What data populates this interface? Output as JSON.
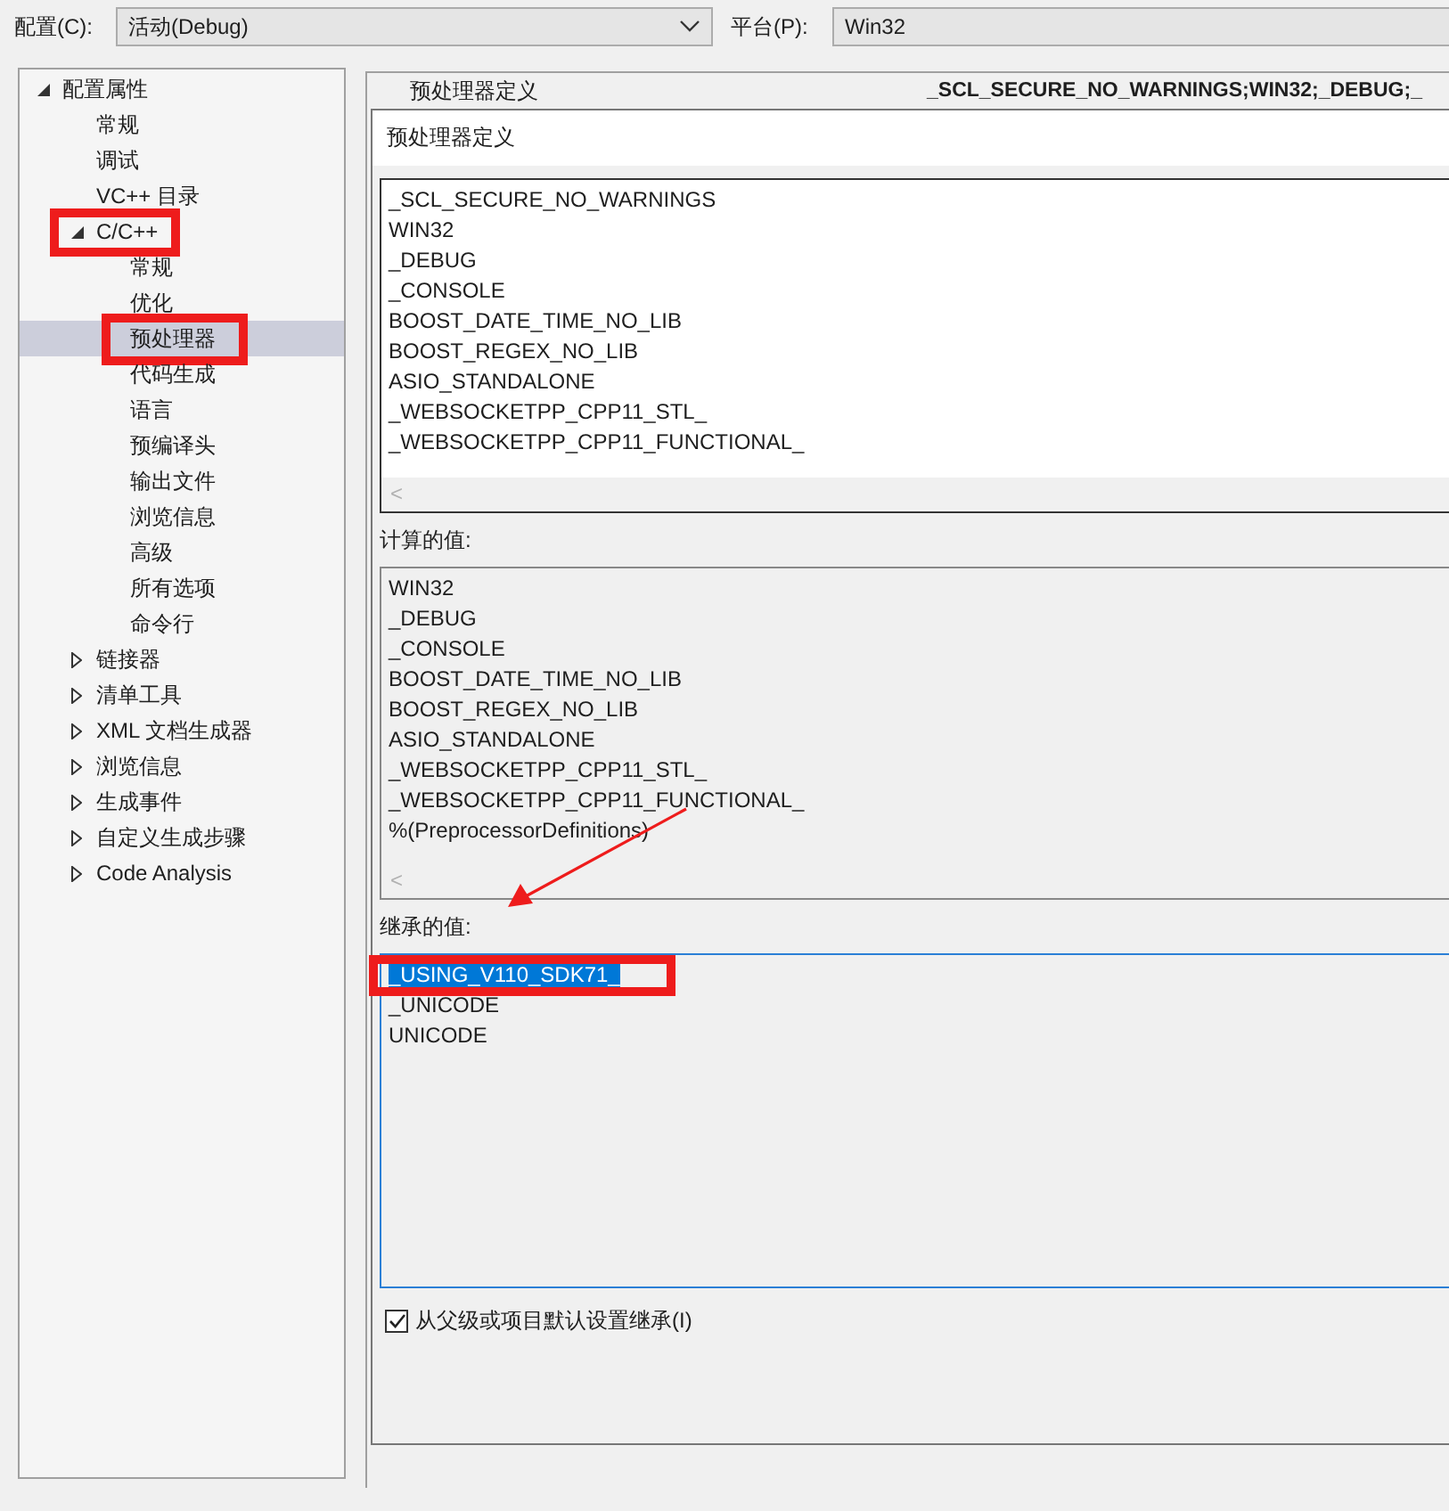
{
  "config_bar": {
    "config_label": "配置(C):",
    "config_value": "活动(Debug)",
    "platform_label": "平台(P):",
    "platform_value": "Win32"
  },
  "tree": [
    {
      "label": "配置属性",
      "expanded": true,
      "selected": false,
      "highlighted": false,
      "children": [
        {
          "label": "常规",
          "selected": false,
          "highlighted": false
        },
        {
          "label": "调试",
          "selected": false,
          "highlighted": false
        },
        {
          "label": "VC++ 目录",
          "selected": false,
          "highlighted": false
        },
        {
          "label": "C/C++",
          "expanded": true,
          "selected": false,
          "highlighted": true,
          "children": [
            {
              "label": "常规",
              "selected": false,
              "highlighted": false
            },
            {
              "label": "优化",
              "selected": false,
              "highlighted": false
            },
            {
              "label": "预处理器",
              "selected": true,
              "highlighted": true
            },
            {
              "label": "代码生成",
              "selected": false,
              "highlighted": false
            },
            {
              "label": "语言",
              "selected": false,
              "highlighted": false
            },
            {
              "label": "预编译头",
              "selected": false,
              "highlighted": false
            },
            {
              "label": "输出文件",
              "selected": false,
              "highlighted": false
            },
            {
              "label": "浏览信息",
              "selected": false,
              "highlighted": false
            },
            {
              "label": "高级",
              "selected": false,
              "highlighted": false
            },
            {
              "label": "所有选项",
              "selected": false,
              "highlighted": false
            },
            {
              "label": "命令行",
              "selected": false,
              "highlighted": false
            }
          ]
        },
        {
          "label": "链接器",
          "expanded": false,
          "selected": false,
          "highlighted": false
        },
        {
          "label": "清单工具",
          "expanded": false,
          "selected": false,
          "highlighted": false
        },
        {
          "label": "XML 文档生成器",
          "expanded": false,
          "selected": false,
          "highlighted": false
        },
        {
          "label": "浏览信息",
          "expanded": false,
          "selected": false,
          "highlighted": false
        },
        {
          "label": "生成事件",
          "expanded": false,
          "selected": false,
          "highlighted": false
        },
        {
          "label": "自定义生成步骤",
          "expanded": false,
          "selected": false,
          "highlighted": false
        },
        {
          "label": "Code Analysis",
          "expanded": false,
          "selected": false,
          "highlighted": false
        }
      ]
    }
  ],
  "property_row": {
    "name": "预处理器定义",
    "value": "_SCL_SECURE_NO_WARNINGS;WIN32;_DEBUG;_"
  },
  "editor": {
    "title": "预处理器定义",
    "definitions": [
      "_SCL_SECURE_NO_WARNINGS",
      "WIN32",
      "_DEBUG",
      "_CONSOLE",
      "BOOST_DATE_TIME_NO_LIB",
      "BOOST_REGEX_NO_LIB",
      "ASIO_STANDALONE",
      "_WEBSOCKETPP_CPP11_STL_",
      "_WEBSOCKETPP_CPP11_FUNCTIONAL_"
    ],
    "scroll_left": "<",
    "computed_label": "计算的值:",
    "computed": [
      "WIN32",
      "_DEBUG",
      "_CONSOLE",
      "BOOST_DATE_TIME_NO_LIB",
      "BOOST_REGEX_NO_LIB",
      "ASIO_STANDALONE",
      "_WEBSOCKETPP_CPP11_STL_",
      "_WEBSOCKETPP_CPP11_FUNCTIONAL_",
      "%(PreprocessorDefinitions)"
    ],
    "computed_scroll_left": "<",
    "inherited_label": "继承的值:",
    "inherited": [
      {
        "text": "_USING_V110_SDK71_",
        "selected": true,
        "highlighted": true
      },
      {
        "text": "_UNICODE",
        "selected": false,
        "highlighted": false
      },
      {
        "text": "UNICODE",
        "selected": false,
        "highlighted": false
      }
    ],
    "inherit_checkbox": {
      "label": "从父级或项目默认设置继承(I)",
      "checked": true
    }
  }
}
